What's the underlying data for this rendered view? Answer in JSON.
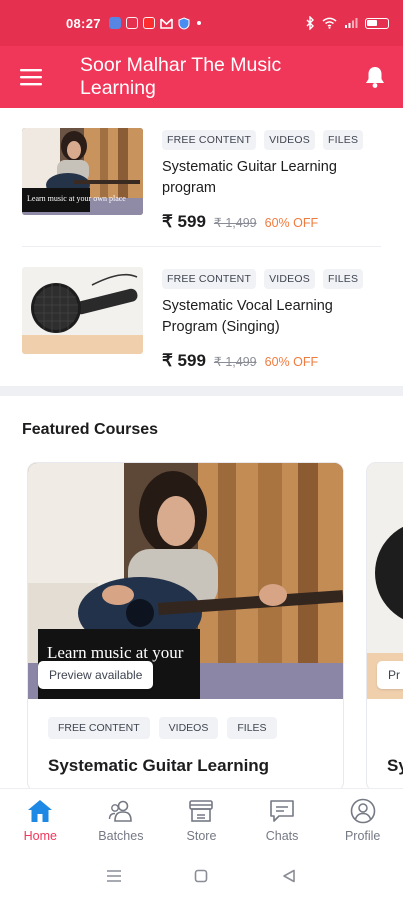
{
  "status_bar": {
    "time": "08:27",
    "battery_level": 0.45
  },
  "app_bar": {
    "title": "Soor Malhar The Music Learning",
    "menu_icon": "hamburger-menu-icon",
    "notification_icon": "bell-icon"
  },
  "courses": [
    {
      "tags": [
        "FREE CONTENT",
        "VIDEOS",
        "FILES"
      ],
      "title": "Systematic Guitar Learning program",
      "price": "₹ 599",
      "mrp": "₹ 1,499",
      "discount": "60% OFF",
      "thumb_caption": "Learn music at your own place"
    },
    {
      "tags": [
        "FREE CONTENT",
        "VIDEOS",
        "FILES"
      ],
      "title": "Systematic Vocal Learning Program (Singing)",
      "price": "₹ 599",
      "mrp": "₹ 1,499",
      "discount": "60% OFF"
    }
  ],
  "featured": {
    "section_title": "Featured Courses",
    "cards": [
      {
        "image_caption": "Learn music at your",
        "preview_label": "Preview available",
        "tags": [
          "FREE CONTENT",
          "VIDEOS",
          "FILES"
        ],
        "title": "Systematic Guitar Learning"
      },
      {
        "preview_label": "Pr",
        "title": "Sy"
      }
    ]
  },
  "bottom_nav": {
    "active": "Home",
    "items": [
      {
        "label": "Home",
        "icon": "home-icon"
      },
      {
        "label": "Batches",
        "icon": "batches-icon"
      },
      {
        "label": "Store",
        "icon": "store-icon"
      },
      {
        "label": "Chats",
        "icon": "chats-icon"
      },
      {
        "label": "Profile",
        "icon": "profile-icon"
      }
    ]
  },
  "colors": {
    "brand": "#f0375a",
    "status_bar": "#e6304f",
    "discount": "#f07b3f"
  }
}
